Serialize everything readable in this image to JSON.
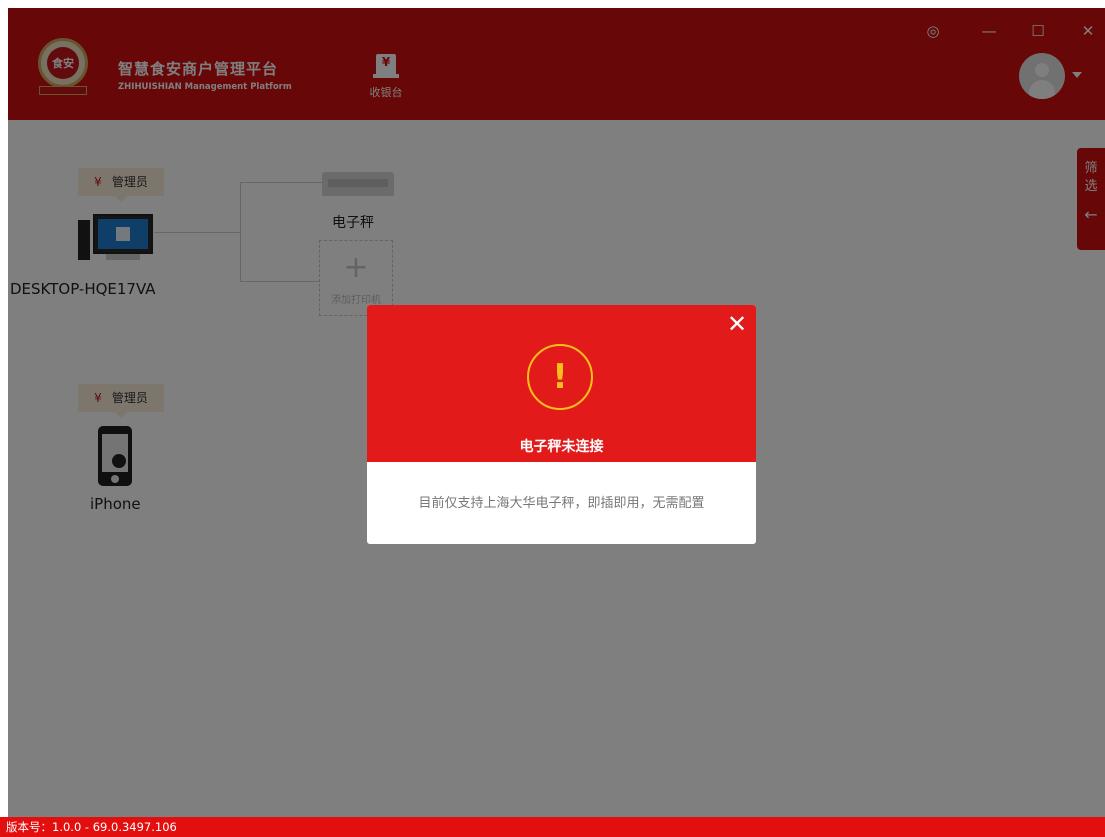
{
  "header": {
    "logo_text": "食安",
    "brand_title": "智慧食安商户管理平台",
    "brand_subtitle": "ZHIHUISHIAN Management Platform",
    "cashier_label": "收银台",
    "cashier_icon": "cashier-icon",
    "window_controls": [
      "settings-icon",
      "minimize-icon",
      "maximize-icon",
      "close-icon"
    ]
  },
  "devices": {
    "pc": {
      "role": "管理员",
      "yen": "¥",
      "name": "DESKTOP-HQE17VA"
    },
    "phone": {
      "role": "管理员",
      "yen": "¥",
      "name": "iPhone"
    },
    "scale_label": "电子秤",
    "add_printer_label": "添加打印机"
  },
  "filter_tab": {
    "label_line1": "筛",
    "label_line2": "选",
    "arrow": "←"
  },
  "modal": {
    "icon": "!",
    "title": "电子秤未连接",
    "message": "目前仅支持上海大华电子秤，即插即用，无需配置",
    "close": "✕"
  },
  "status_bar": {
    "version_text": "版本号：1.0.0 - 69.0.3497.106"
  },
  "colors": {
    "brand_red": "#ce0f0f",
    "modal_red": "#e31a1a",
    "warning_yellow": "#f5c01a"
  }
}
